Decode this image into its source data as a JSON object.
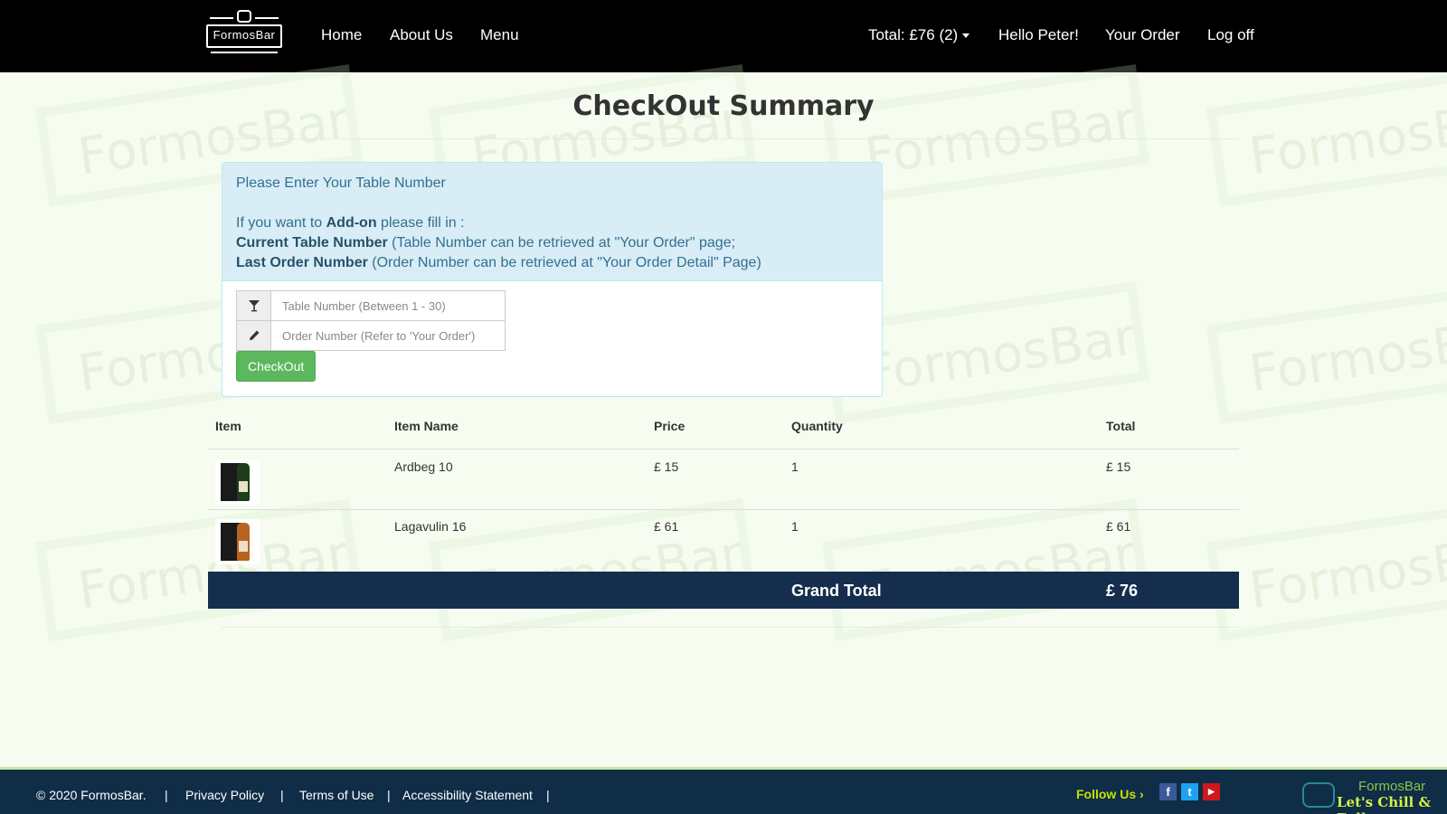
{
  "navbar": {
    "logo_text": "FormosBar",
    "links": [
      "Home",
      "About Us",
      "Menu"
    ],
    "cart_total": "Total: £76 (2)",
    "greeting": "Hello Peter!",
    "your_order": "Your Order",
    "logoff": "Log off"
  },
  "watermark": {
    "text": "FormosBar",
    "tagline": "Chill & Full"
  },
  "page_title": "CheckOut Summary",
  "panel": {
    "heading": "Please Enter Your Table Number",
    "addon_intro_pre": "If you want to ",
    "addon_intro_bold": "Add-on",
    "addon_intro_post": " please fill in :",
    "line1_bold": "Current Table Number",
    "line1_text": " (Table Number can be retrieved at \"Your Order\" page;",
    "line2_bold": "Last Order Number",
    "line2_text": " (Order Number can be retrieved at \"Your Order Detail\" Page)",
    "table_input_placeholder": "Table Number (Between 1 - 30)",
    "order_input_placeholder": "Order Number (Refer to 'Your Order')",
    "checkout_button": "CheckOut",
    "icons": [
      "glass-icon",
      "pencil-icon"
    ]
  },
  "table": {
    "headers": [
      "Item",
      "Item Name",
      "Price",
      "Quantity",
      "Total"
    ],
    "rows": [
      {
        "name": "Ardbeg 10",
        "price": "£ 15",
        "quantity": "1",
        "total": "£ 15"
      },
      {
        "name": "Lagavulin 16",
        "price": "£ 61",
        "quantity": "1",
        "total": "£ 61"
      }
    ],
    "grand_total_label": "Grand Total",
    "grand_total_value": "£ 76"
  },
  "footer": {
    "copyright": "© 2020 FormosBar.",
    "links": [
      "Privacy Policy",
      "Terms of Use",
      "Accessibility Statement"
    ],
    "separator": "|",
    "follow_us": "Follow Us",
    "social": [
      "facebook-icon",
      "twitter-icon",
      "youtube-icon"
    ],
    "brand_name": "FormosBar",
    "brand_tagline": "Let's Chill & Full"
  },
  "colors": {
    "navbar": "#000000",
    "background": "#f6fcef",
    "panel_heading": "#d9edf7",
    "checkout_button": "#5cb85c",
    "grand_total_bar": "#152e4d",
    "footer": "#0f2d47"
  }
}
